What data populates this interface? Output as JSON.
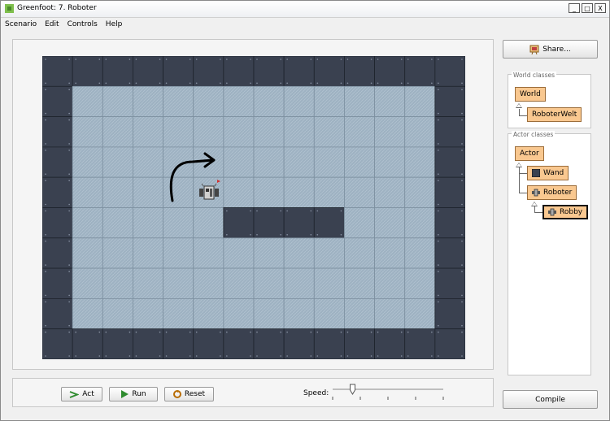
{
  "window": {
    "title": "Greenfoot: 7. Roboter",
    "minimize": "_",
    "maximize": "□",
    "close": "X"
  },
  "menu": [
    "Scenario",
    "Edit",
    "Controls",
    "Help"
  ],
  "controls": {
    "act": "Act",
    "run": "Run",
    "reset": "Reset",
    "speed_label": "Speed:",
    "speed_value": 0.18
  },
  "sidebar": {
    "share": "Share...",
    "world_classes_label": "World classes",
    "world_classes": [
      "World",
      "RoboterWelt"
    ],
    "actor_classes_label": "Actor classes",
    "actor_classes": [
      "Actor",
      "Wand",
      "Roboter",
      "Robby"
    ],
    "compile": "Compile"
  },
  "world": {
    "columns": 14,
    "rows": 10,
    "inner_walls": [
      [
        6,
        5
      ],
      [
        7,
        5
      ],
      [
        8,
        5
      ],
      [
        9,
        5
      ]
    ],
    "robot_cell": [
      5,
      4
    ]
  },
  "colors": {
    "wall": "#3a4150",
    "floor": "#9eb2c2",
    "class_fill": "#f9c890",
    "run_green": "#2e8b2e"
  }
}
